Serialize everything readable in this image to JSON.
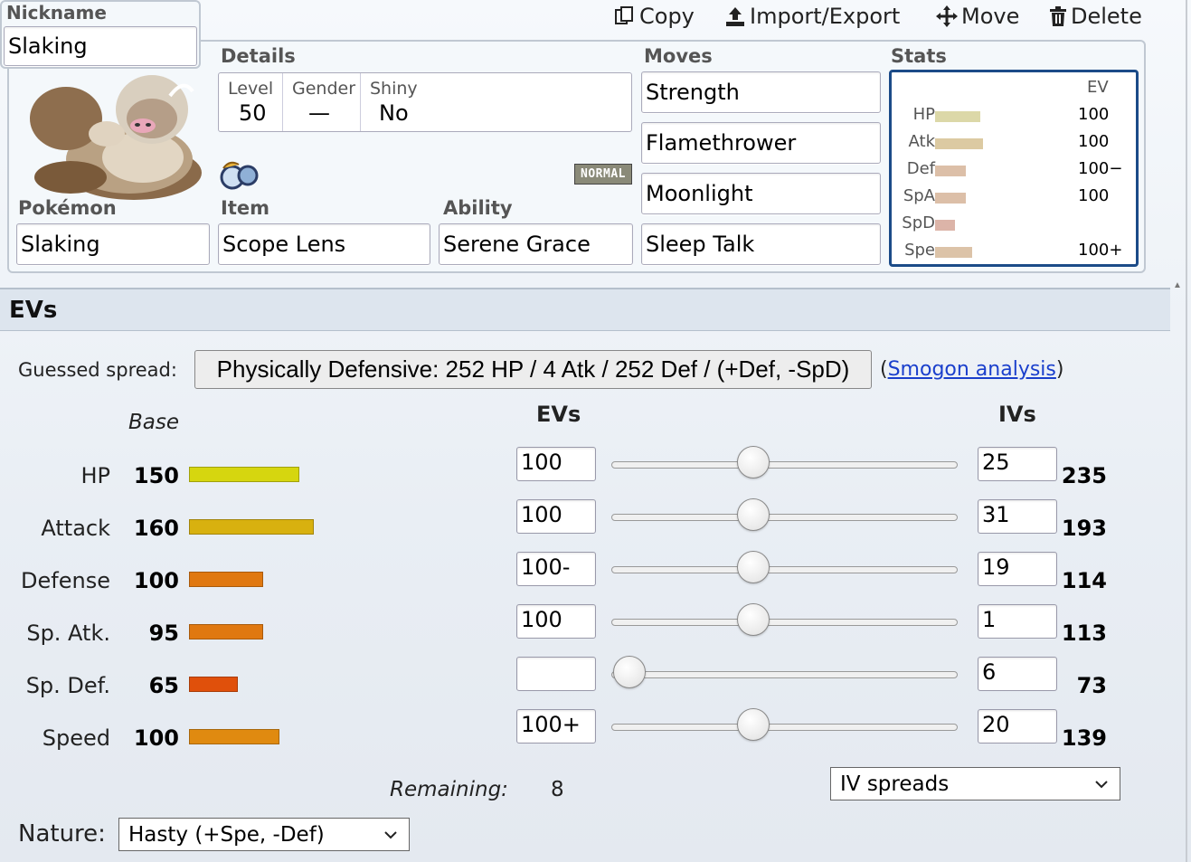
{
  "nickname": {
    "label": "Nickname",
    "value": "Slaking"
  },
  "toolbar": {
    "copy": "Copy",
    "import_export": "Import/Export",
    "move": "Move",
    "delete": "Delete"
  },
  "details": {
    "label": "Details",
    "level_label": "Level",
    "level": "50",
    "gender_label": "Gender",
    "gender": "—",
    "shiny_label": "Shiny",
    "shiny": "No",
    "type_badge": "NORMAL"
  },
  "pokemon": {
    "label": "Pokémon",
    "value": "Slaking"
  },
  "item": {
    "label": "Item",
    "value": "Scope Lens"
  },
  "ability": {
    "label": "Ability",
    "value": "Serene Grace"
  },
  "moves": {
    "label": "Moves",
    "list": [
      "Strength",
      "Flamethrower",
      "Moonlight",
      "Sleep Talk"
    ]
  },
  "stats_box": {
    "label": "Stats",
    "ev_header": "EV",
    "rows": [
      {
        "name": "HP",
        "ev": "100"
      },
      {
        "name": "Atk",
        "ev": "100"
      },
      {
        "name": "Def",
        "ev": "100−"
      },
      {
        "name": "SpA",
        "ev": "100"
      },
      {
        "name": "SpD",
        "ev": ""
      },
      {
        "name": "Spe",
        "ev": "100+"
      }
    ]
  },
  "evs_section": {
    "title": "EVs",
    "guessed_label": "Guessed spread:",
    "guessed_value": "Physically Defensive: 252 HP / 4 Atk / 252 Def / (+Def, -SpD)",
    "smogon_open": "(",
    "smogon_link": "Smogon analysis",
    "smogon_close": ")",
    "base_header": "Base",
    "evs_header": "EVs",
    "ivs_header": "IVs",
    "rows": [
      {
        "name": "HP",
        "base": "150",
        "ev": "100",
        "iv": "25",
        "total": "235",
        "slider": 100
      },
      {
        "name": "Attack",
        "base": "160",
        "ev": "100",
        "iv": "31",
        "total": "193",
        "slider": 100
      },
      {
        "name": "Defense",
        "base": "100",
        "ev": "100-",
        "iv": "19",
        "total": "114",
        "slider": 100
      },
      {
        "name": "Sp. Atk.",
        "base": "95",
        "ev": "100",
        "iv": "1",
        "total": "113",
        "slider": 100
      },
      {
        "name": "Sp. Def.",
        "base": "65",
        "ev": "",
        "iv": "6",
        "total": "73",
        "slider": 0
      },
      {
        "name": "Speed",
        "base": "100",
        "ev": "100+",
        "iv": "20",
        "total": "139",
        "slider": 100
      }
    ],
    "remaining_label": "Remaining:",
    "remaining_value": "8",
    "iv_spreads": "IV spreads",
    "nature_label": "Nature:",
    "nature_value": "Hasty (+Spe, -Def)"
  },
  "colors": {
    "hp": "#d6d60f",
    "atk": "#d8b10f",
    "def": "#e07810",
    "spa": "#e07810",
    "spd": "#e0500b",
    "spe": "#e08a10",
    "stat_small_hp": "#dcd8a8",
    "stat_small_atk": "#dccaa2",
    "stat_small_def": "#dcbfa8",
    "stat_small_spa": "#dcbfa8",
    "stat_small_spd": "#dcb4a8",
    "stat_small_spe": "#dcc3a8"
  }
}
